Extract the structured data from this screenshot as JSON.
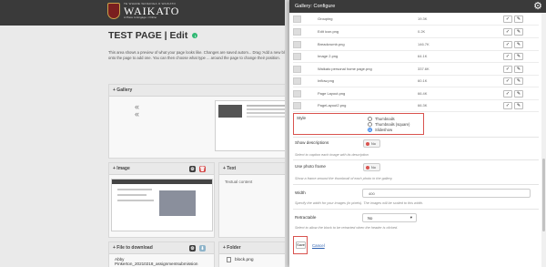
{
  "header": {
    "logo_sub": "TE WHARE WANANGA O WAIKATO",
    "logo_name": "WAIKATO",
    "logo_tag": "A Place to Engage • Online"
  },
  "page": {
    "title": "TEST PAGE | Edit",
    "info_icon": "i",
    "intro": "This area shows a preview of what your page looks like. Changes are saved autom... Drag 'Add a new block' onto the page to add one. You can then choose what type ... around the page to change their position."
  },
  "blocks": {
    "gallery": {
      "title": "+ Gallery",
      "prev": "«",
      "prev2": "«"
    },
    "image": {
      "title": "+ Image",
      "gear": "⚙",
      "trash": "🗑"
    },
    "text": {
      "title": "+ Text",
      "body": "Textual content"
    },
    "file": {
      "title": "+ File to download",
      "gear": "⚙",
      "download": "⬇",
      "name": "Abby",
      "detail": "Pinkerton_20210218_assignmentsubmission"
    },
    "folder": {
      "title": "+ Folder",
      "file": "block.png"
    }
  },
  "modal": {
    "title": "Gallery: Configure",
    "gear_icon": "⚙",
    "edit_glyph": "✓",
    "pencil_glyph": "✎",
    "files": [
      {
        "name": "Grouping",
        "size": "19.3K"
      },
      {
        "name": "Edit icon.png",
        "size": "0.2K"
      },
      {
        "name": "Breadcrumb.png",
        "size": "146.7K"
      },
      {
        "name": "Image 2.png",
        "size": "64.1K"
      },
      {
        "name": "Waikato personal home page.png",
        "size": "337.6K"
      },
      {
        "name": "Inflow.png",
        "size": "60.1K"
      },
      {
        "name": "Page Layout.png",
        "size": "66.4K"
      },
      {
        "name": "PageLayout2.png",
        "size": "66.3K"
      }
    ],
    "style": {
      "label": "Style",
      "options": [
        "Thumbnails",
        "Thumbnails (square)",
        "Slideshow"
      ],
      "selected": "Slideshow"
    },
    "show_descriptions": {
      "label": "Show descriptions",
      "toggle": "No",
      "help": "Select to caption each image with its description"
    },
    "photo_frame": {
      "label": "Use photo frame",
      "toggle": "No",
      "help": "Show a frame around the thumbnail of each photo in the gallery."
    },
    "width": {
      "label": "Width",
      "value": "400",
      "help": "Specify the width for your images (in pixels). The images will be scaled to this width."
    },
    "retractable": {
      "label": "Retractable",
      "value": "No",
      "chevron": "▾",
      "help": "Select to allow the block to be retracted when the header is clicked."
    },
    "save_label": "Save",
    "cancel_label": "Cancel"
  }
}
